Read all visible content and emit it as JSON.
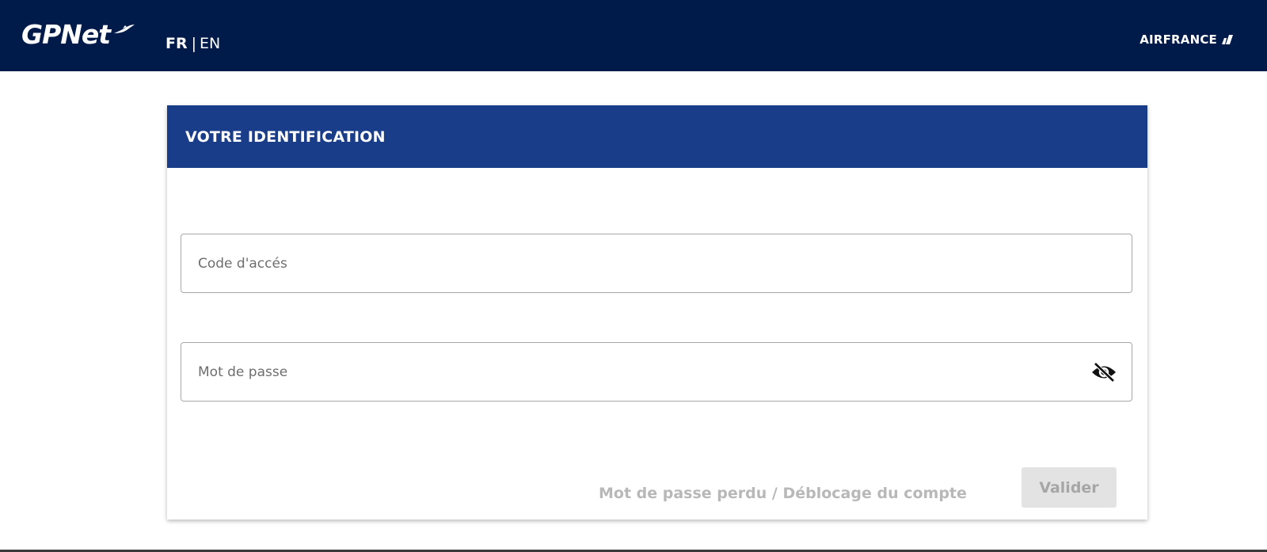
{
  "header": {
    "logo_text": "GPNet",
    "lang_fr": "FR",
    "lang_separator": "|",
    "lang_en": "EN",
    "brand_text": "AIRFRANCE",
    "background_color": "#001b4a"
  },
  "login": {
    "title": "VOTRE IDENTIFICATION",
    "header_color": "#1a3d8a",
    "access_code_placeholder": "Code d'accés",
    "password_placeholder": "Mot de passe",
    "password_toggle_icon": "eye-off-icon",
    "forgot_link": "Mot de passe perdu / Déblocage du compte",
    "submit_label": "Valider"
  }
}
